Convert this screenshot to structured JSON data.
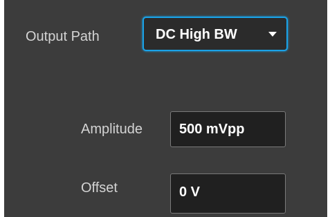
{
  "output_path": {
    "label": "Output Path",
    "selected": "DC High BW",
    "dropdown_icon": "chevron-down-icon"
  },
  "amplitude": {
    "label": "Amplitude",
    "value": "500 mVpp"
  },
  "offset": {
    "label": "Offset",
    "value": "0 V"
  },
  "colors": {
    "panel_background": "#3c3c3c",
    "focus_border": "#1aa3e8",
    "field_background": "#202020",
    "label_text": "#d4d4d4",
    "value_text": "#ffffff"
  }
}
